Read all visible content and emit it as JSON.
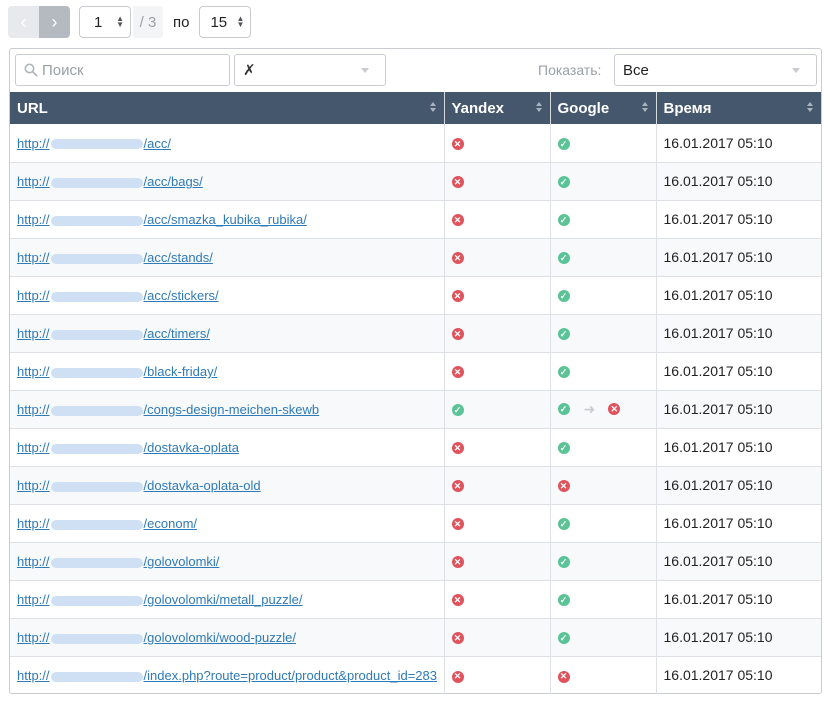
{
  "pager": {
    "prev_icon": "‹",
    "next_icon": "›",
    "current_page": "1",
    "total_pages": "/ 3",
    "per_label": "по",
    "per_page": "15"
  },
  "filters": {
    "search_placeholder": "Поиск",
    "clear_symbol": "✗",
    "show_label": "Показать:",
    "show_value": "Все"
  },
  "table": {
    "columns": [
      "URL",
      "Yandex",
      "Google",
      "Время"
    ],
    "rows": [
      {
        "prefix": "http://",
        "path": "/acc/",
        "yandex": "no",
        "google": "ok",
        "time": "16.01.2017 05:10"
      },
      {
        "prefix": "http://",
        "path": "/acc/bags/",
        "yandex": "no",
        "google": "ok",
        "time": "16.01.2017 05:10"
      },
      {
        "prefix": "http://",
        "path": "/acc/smazka_kubika_rubika/",
        "yandex": "no",
        "google": "ok",
        "time": "16.01.2017 05:10"
      },
      {
        "prefix": "http://",
        "path": "/acc/stands/",
        "yandex": "no",
        "google": "ok",
        "time": "16.01.2017 05:10"
      },
      {
        "prefix": "http://",
        "path": "/acc/stickers/",
        "yandex": "no",
        "google": "ok",
        "time": "16.01.2017 05:10"
      },
      {
        "prefix": "http://",
        "path": "/acc/timers/",
        "yandex": "no",
        "google": "ok",
        "time": "16.01.2017 05:10"
      },
      {
        "prefix": "http://",
        "path": "/black-friday/",
        "yandex": "no",
        "google": "ok",
        "time": "16.01.2017 05:10"
      },
      {
        "prefix": "http://",
        "path": "/congs-design-meichen-skewb",
        "yandex": "ok",
        "google": "ok",
        "google_to": "no",
        "time": "16.01.2017 05:10"
      },
      {
        "prefix": "http://",
        "path": "/dostavka-oplata",
        "yandex": "no",
        "google": "ok",
        "time": "16.01.2017 05:10"
      },
      {
        "prefix": "http://",
        "path": "/dostavka-oplata-old",
        "yandex": "no",
        "google": "no",
        "time": "16.01.2017 05:10"
      },
      {
        "prefix": "http://",
        "path": "/econom/",
        "yandex": "no",
        "google": "ok",
        "time": "16.01.2017 05:10"
      },
      {
        "prefix": "http://",
        "path": "/golovolomki/",
        "yandex": "no",
        "google": "ok",
        "time": "16.01.2017 05:10"
      },
      {
        "prefix": "http://",
        "path": "/golovolomki/metall_puzzle/",
        "yandex": "no",
        "google": "ok",
        "time": "16.01.2017 05:10"
      },
      {
        "prefix": "http://",
        "path": "/golovolomki/wood-puzzle/",
        "yandex": "no",
        "google": "ok",
        "time": "16.01.2017 05:10"
      },
      {
        "prefix": "http://",
        "path": "/index.php?route=product/product&product_id=283",
        "yandex": "no",
        "google": "no",
        "time": "16.01.2017 05:10"
      }
    ]
  },
  "status_glyphs": {
    "ok": "✓",
    "no": "✕"
  },
  "colors": {
    "header_bg": "#45576d",
    "ok": "#5bc496",
    "no": "#e0525c",
    "link": "#2f7ab7"
  }
}
